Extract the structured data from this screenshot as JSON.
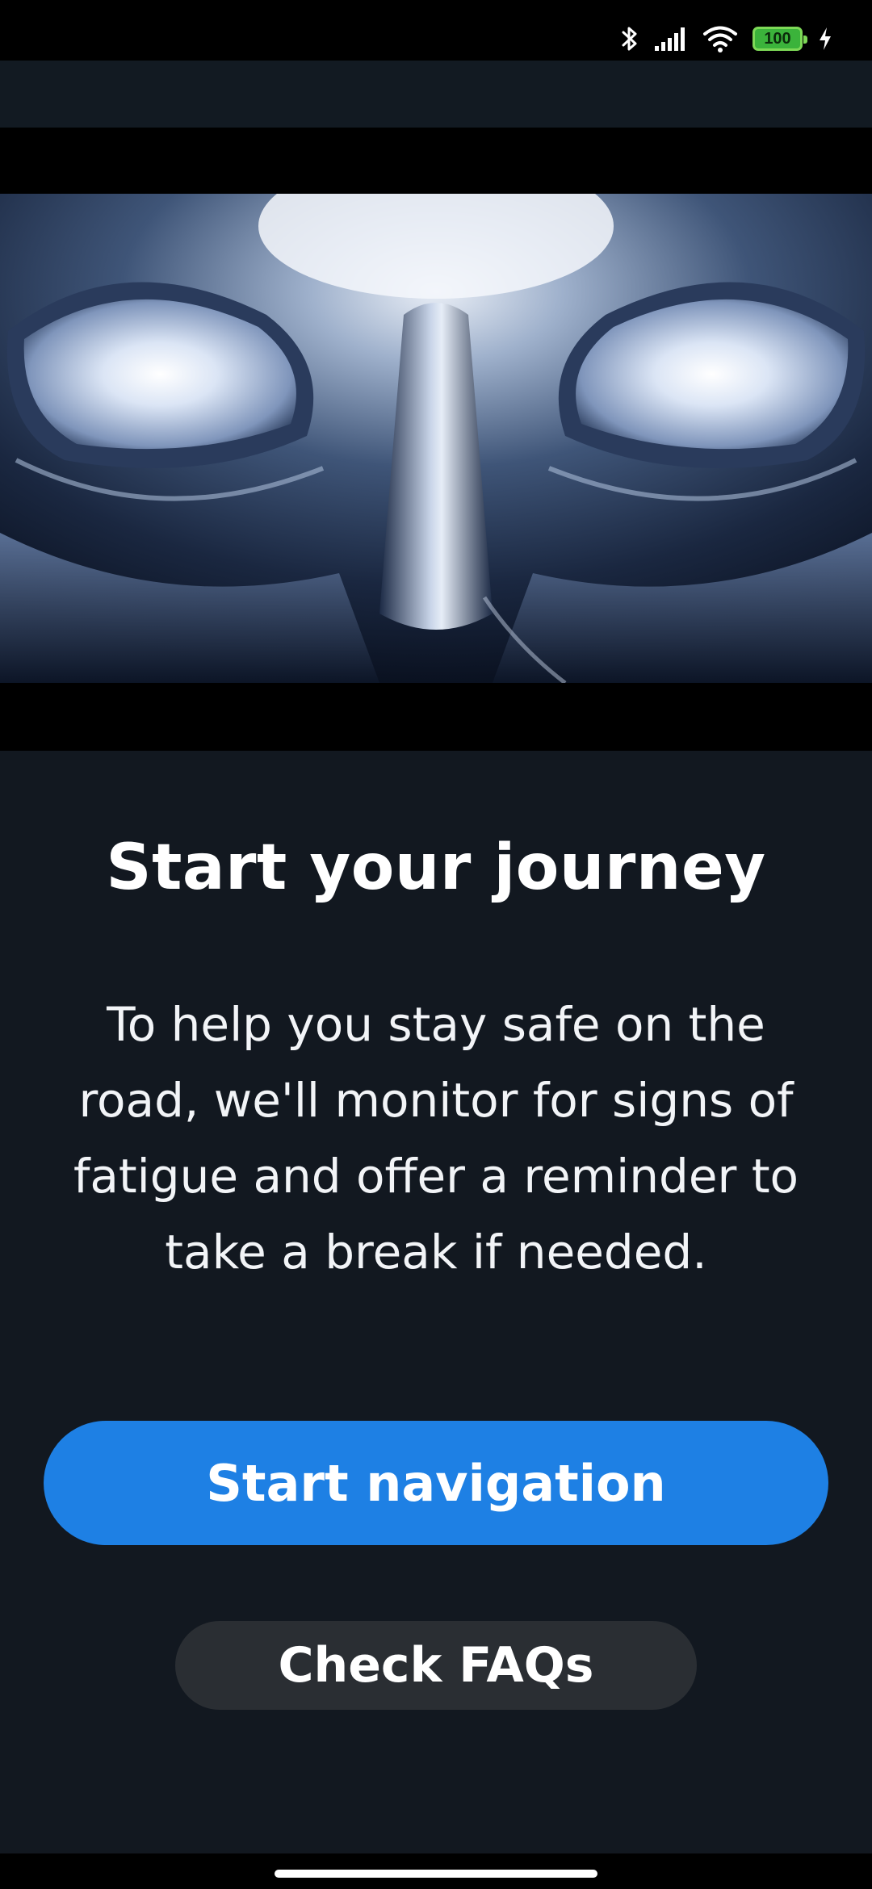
{
  "status_bar": {
    "battery_level": "100",
    "icons": [
      "bluetooth-icon",
      "signal-icon",
      "wifi-icon",
      "battery-icon",
      "charging-icon"
    ]
  },
  "hero": {
    "image_description": "chrome-face-eyes-image"
  },
  "content": {
    "title": "Start your journey",
    "description": "To help you stay safe on the road, we'll monitor for signs of fatigue and offer a reminder to take a break if needed."
  },
  "actions": {
    "primary_label": "Start navigation",
    "secondary_label": "Check FAQs"
  },
  "colors": {
    "background": "#121820",
    "primary": "#1e80e4",
    "secondary": "#2a2e33",
    "battery": "#3bb33b"
  }
}
